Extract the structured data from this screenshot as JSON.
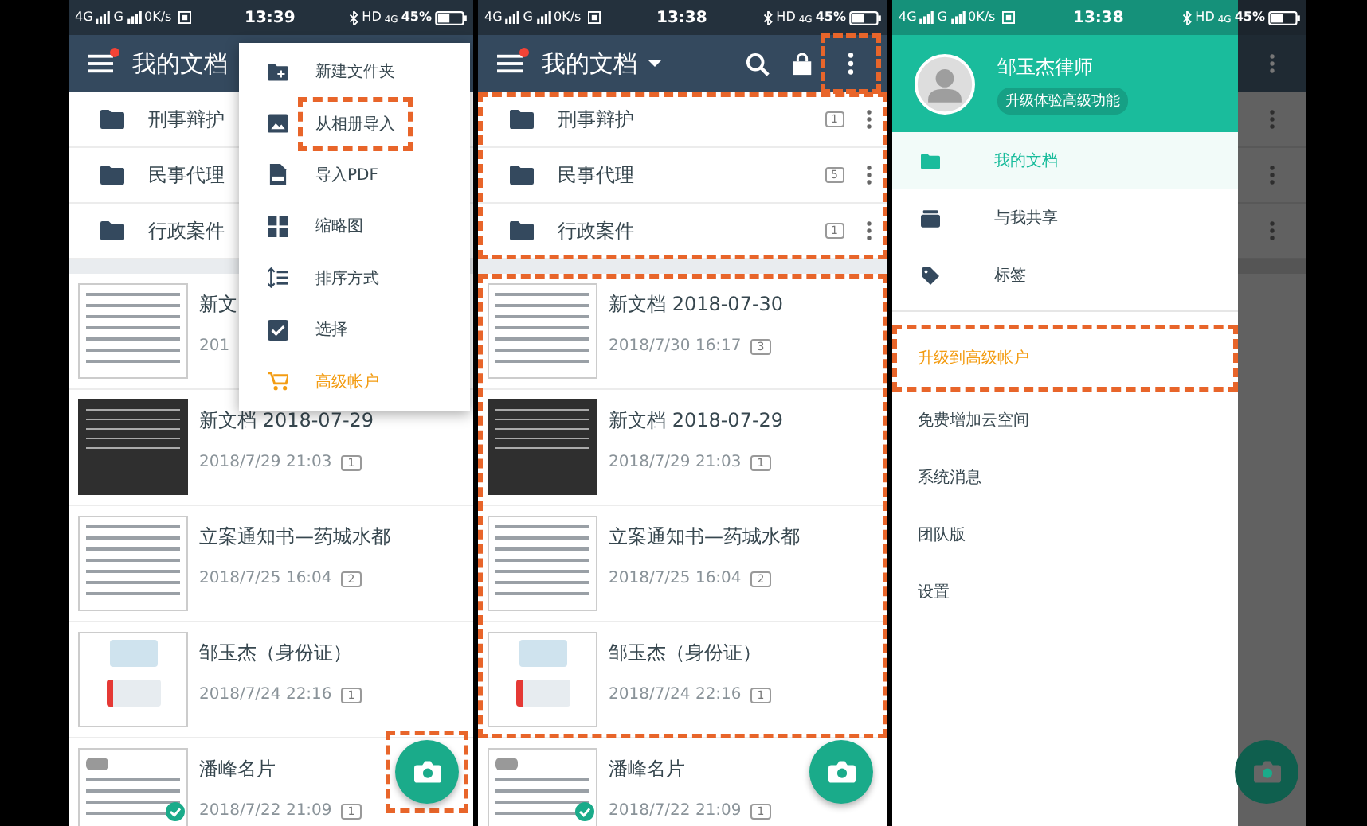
{
  "screens": [
    {
      "kind": "list",
      "status_bar": {
        "carrier_1": "4G",
        "carrier_2": "G",
        "speed": "0K/s",
        "time": "13:39",
        "hd": "HD",
        "network": "4G",
        "battery": "45%"
      },
      "app_bar": {
        "title": "我的文档",
        "notification_dot": true
      },
      "folders": {
        "highlighted": false,
        "items": [
          {
            "name": "刑事辩护"
          },
          {
            "name": "民事代理"
          },
          {
            "name": "行政案件"
          }
        ]
      },
      "document_groups": [
        {
          "highlighted": false,
          "items": [
            {
              "title": "新文",
              "date": "201",
              "kind": "document",
              "synced": false
            },
            {
              "title": "新文档 2018-07-29",
              "date": "2018/7/29 21:03",
              "pages": "1",
              "kind": "dark",
              "synced": false
            },
            {
              "title": "立案通知书—药城水都",
              "date": "2018/7/25 16:04",
              "pages": "2",
              "kind": "document",
              "synced": false
            },
            {
              "title": "邹玉杰（身份证）",
              "date": "2018/7/24 22:16",
              "pages": "1",
              "kind": "id-card",
              "synced": false
            },
            {
              "title": "潘峰名片",
              "date": "2018/7/22 21:09",
              "pages": "1",
              "kind": "business-card",
              "synced": true
            }
          ]
        }
      ],
      "fab": {
        "highlighted": true
      },
      "overflow_menu": {
        "items": [
          {
            "label": "新建文件夹",
            "kind": "normal",
            "highlighted": false
          },
          {
            "label": "从相册导入",
            "kind": "normal",
            "highlighted": true
          },
          {
            "label": "导入PDF",
            "kind": "normal",
            "highlighted": false
          },
          {
            "label": "缩略图",
            "kind": "normal",
            "highlighted": false
          },
          {
            "label": "排序方式",
            "kind": "normal",
            "highlighted": false
          },
          {
            "label": "选择",
            "kind": "normal",
            "highlighted": false
          },
          {
            "label": "高级帐户",
            "kind": "premium",
            "highlighted": false
          }
        ]
      }
    },
    {
      "kind": "list",
      "status_bar": {
        "carrier_1": "4G",
        "carrier_2": "G",
        "speed": "0K/s",
        "time": "13:38",
        "hd": "HD",
        "network": "4G",
        "battery": "45%"
      },
      "app_bar": {
        "title": "我的文档",
        "notification_dot": true,
        "actions": [
          {
            "kind": "search",
            "highlighted": false
          },
          {
            "kind": "bag",
            "highlighted": false
          },
          {
            "kind": "more",
            "highlighted": true
          }
        ]
      },
      "folders": {
        "highlighted": true,
        "items": [
          {
            "name": "刑事辩护",
            "count": "1"
          },
          {
            "name": "民事代理",
            "count": "5"
          },
          {
            "name": "行政案件",
            "count": "1"
          }
        ]
      },
      "document_groups": [
        {
          "highlighted": true,
          "items": [
            {
              "title": "新文档 2018-07-30",
              "date": "2018/7/30 16:17",
              "pages": "3",
              "kind": "document",
              "synced": false
            },
            {
              "title": "新文档 2018-07-29",
              "date": "2018/7/29 21:03",
              "pages": "1",
              "kind": "dark",
              "synced": false
            },
            {
              "title": "立案通知书—药城水都",
              "date": "2018/7/25 16:04",
              "pages": "2",
              "kind": "document",
              "synced": false
            },
            {
              "title": "邹玉杰（身份证）",
              "date": "2018/7/24 22:16",
              "pages": "1",
              "kind": "id-card",
              "synced": false
            }
          ]
        },
        {
          "highlighted": false,
          "items": [
            {
              "title": "潘峰名片",
              "date": "2018/7/22 21:09",
              "pages": "1",
              "kind": "business-card",
              "synced": true
            }
          ]
        }
      ],
      "fab": {
        "highlighted": false
      }
    },
    {
      "kind": "drawer",
      "status_bar": {
        "carrier_1": "4G",
        "carrier_2": "G",
        "speed": "0K/s",
        "time": "13:38",
        "hd": "HD",
        "network": "4G",
        "battery": "45%"
      },
      "drawer": {
        "user_name": "邹玉杰律师",
        "badge": "升级体验高级功能",
        "items": [
          {
            "label": "我的文档",
            "kind": "section",
            "selected": true,
            "highlighted": false
          },
          {
            "label": "与我共享",
            "kind": "section",
            "selected": false,
            "highlighted": false
          },
          {
            "label": "标签",
            "kind": "section",
            "selected": false,
            "highlighted": false
          },
          {
            "label": "升级到高级帐户",
            "kind": "upgrade",
            "selected": false,
            "highlighted": true
          },
          {
            "label": "免费增加云空间",
            "kind": "link",
            "selected": false,
            "highlighted": false
          },
          {
            "label": "系统消息",
            "kind": "link",
            "selected": false,
            "highlighted": false
          },
          {
            "label": "团队版",
            "kind": "link",
            "selected": false,
            "highlighted": false
          },
          {
            "label": "设置",
            "kind": "link",
            "selected": false,
            "highlighted": false
          }
        ]
      }
    }
  ]
}
